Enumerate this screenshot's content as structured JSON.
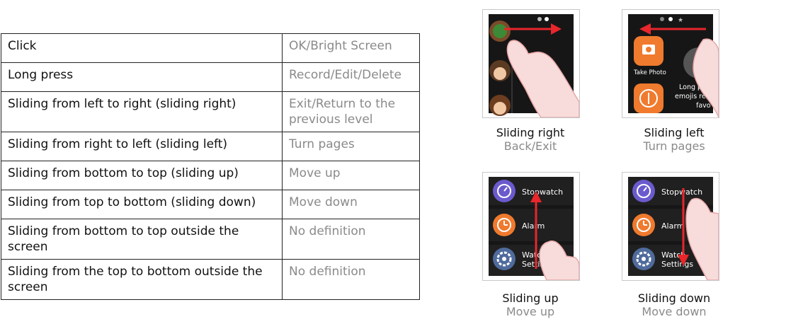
{
  "table": {
    "rows": [
      {
        "gesture": "Click",
        "action": "OK/Bright Screen"
      },
      {
        "gesture": "Long press",
        "action": "Record/Edit/Delete"
      },
      {
        "gesture": "Sliding from left to right (sliding right)",
        "action": "Exit/Return to the previous level"
      },
      {
        "gesture": "Sliding from right to left (sliding left)",
        "action": "Turn pages"
      },
      {
        "gesture": "Sliding from bottom to top (sliding up)",
        "action": "Move up"
      },
      {
        "gesture": "Sliding from top to bottom (sliding down)",
        "action": "Move down"
      },
      {
        "gesture": "Sliding from bottom to top outside the screen",
        "action": "No definition"
      },
      {
        "gesture": "Sliding from the top to bottom outside the screen",
        "action": "No definition"
      }
    ]
  },
  "cards": [
    {
      "title": "Sliding right",
      "subtitle": "Back/Exit"
    },
    {
      "title": "Sliding left",
      "subtitle": "Turn pages"
    },
    {
      "title": "Sliding up",
      "subtitle": "Move up"
    },
    {
      "title": "Sliding down",
      "subtitle": "Move down"
    }
  ],
  "screens": {
    "left": {
      "take_photo": "Take Photo",
      "long_text_1": "Long p",
      "long_text_2": "emojis reco",
      "long_text_3": "favo"
    },
    "list": {
      "stopwatch": "Stopwatch",
      "alarm": "Alarm",
      "settings_1": "Watch",
      "settings_2": "Settings"
    }
  },
  "colors": {
    "arrow": "#e8262b",
    "hand": "#f8dcdc",
    "hand_outline": "#e9a6a6",
    "watch_bg": "#161616",
    "accent_orange": "#f07a2e",
    "label_gray": "#8a8a8a"
  }
}
